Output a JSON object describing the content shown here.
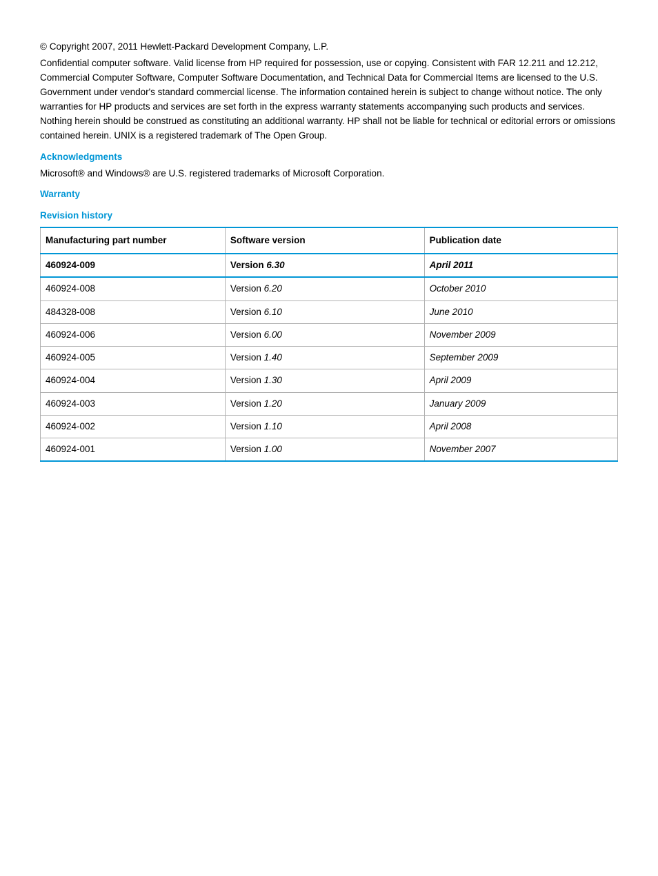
{
  "copyright": "© Copyright 2007, 2011 Hewlett-Packard Development Company, L.P.",
  "legal_text": "Confidential computer software. Valid license from HP required for possession, use or copying. Consistent with FAR 12.211 and 12.212, Commercial Computer Software, Computer Software Documentation, and Technical Data for Commercial Items are licensed to the U.S. Government under vendor's standard commercial license. The information contained herein is subject to change without notice. The only warranties for HP products and services are set forth in the express warranty statements accompanying such products and services. Nothing herein should be construed as constituting an additional warranty. HP shall not be liable for technical or editorial errors or omissions contained herein. UNIX is a registered trademark of The Open Group.",
  "sections": {
    "acknowledgments_heading": "Acknowledgments",
    "acknowledgments_text": "Microsoft® and Windows® are U.S. registered trademarks of Microsoft Corporation.",
    "warranty_heading": "Warranty",
    "revision_heading": "Revision history"
  },
  "table": {
    "headers": {
      "col1": "Manufacturing part number",
      "col2": "Software version",
      "col3": "Publication date"
    },
    "version_prefix": "Version ",
    "rows": [
      {
        "part": "460924-009",
        "version": "6.30",
        "date": "April 2011",
        "highlight": true
      },
      {
        "part": "460924-008",
        "version": "6.20",
        "date": "October 2010",
        "highlight": false
      },
      {
        "part": "484328-008",
        "version": "6.10",
        "date": "June 2010",
        "highlight": false
      },
      {
        "part": "460924-006",
        "version": "6.00",
        "date": "November 2009",
        "highlight": false
      },
      {
        "part": "460924-005",
        "version": "1.40",
        "date": "September 2009",
        "highlight": false
      },
      {
        "part": "460924-004",
        "version": "1.30",
        "date": "April 2009",
        "highlight": false
      },
      {
        "part": "460924-003",
        "version": "1.20",
        "date": "January 2009",
        "highlight": false
      },
      {
        "part": "460924-002",
        "version": "1.10",
        "date": "April 2008",
        "highlight": false
      },
      {
        "part": "460924-001",
        "version": "1.00",
        "date": "November 2007",
        "highlight": false
      }
    ]
  }
}
